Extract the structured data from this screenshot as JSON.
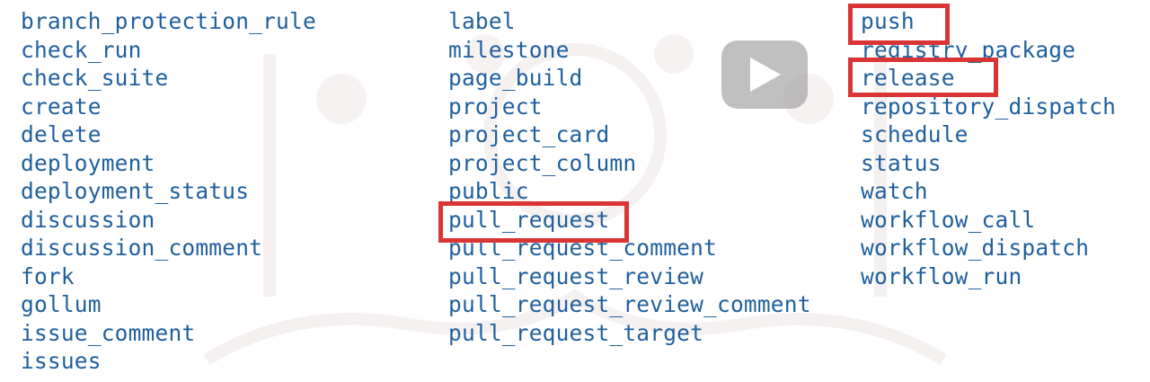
{
  "events": {
    "column1": [
      "branch_protection_rule",
      "check_run",
      "check_suite",
      "create",
      "delete",
      "deployment",
      "deployment_status",
      "discussion",
      "discussion_comment",
      "fork",
      "gollum",
      "issue_comment",
      "issues"
    ],
    "column2": [
      "label",
      "milestone",
      "page_build",
      "project",
      "project_card",
      "project_column",
      "public",
      "pull_request",
      "pull_request_comment",
      "pull_request_review",
      "pull_request_review_comment",
      "pull_request_target"
    ],
    "column3": [
      "push",
      "registry_package",
      "release",
      "repository_dispatch",
      "schedule",
      "status",
      "watch",
      "workflow_call",
      "workflow_dispatch",
      "workflow_run"
    ]
  },
  "highlighted": [
    "push",
    "release",
    "pull_request"
  ],
  "colors": {
    "text": "#1f5f9e",
    "highlight": "#d93535",
    "background": "#ffffff"
  },
  "overlay": {
    "icon": "play-icon"
  }
}
